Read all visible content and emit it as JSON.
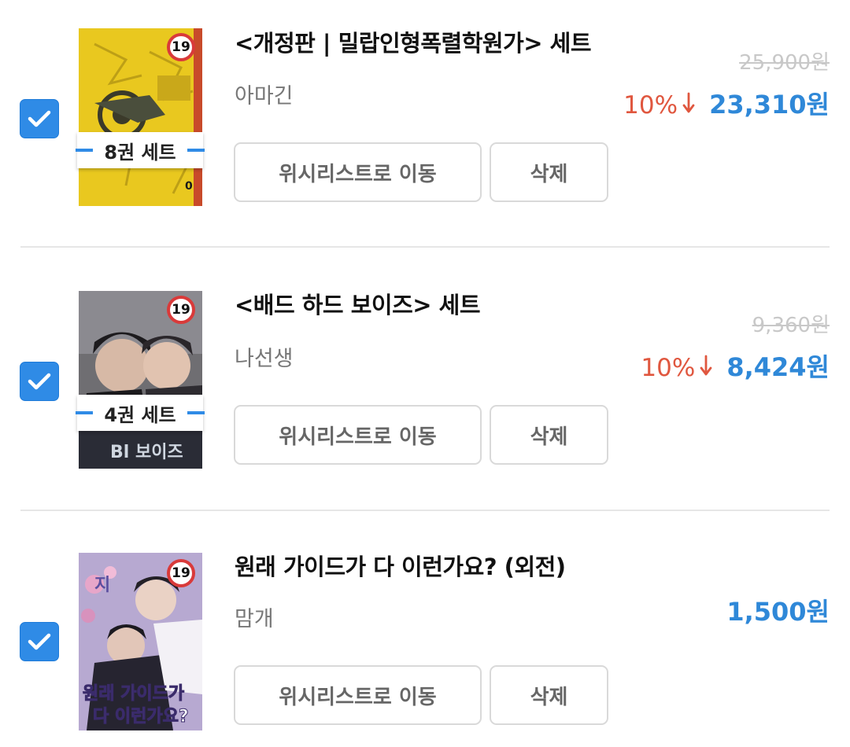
{
  "items": [
    {
      "title": "<개정판 | 밀랍인형폭렬학원가> 세트",
      "author": "아마긴",
      "set_label": "8권 세트",
      "age": "19",
      "original_price": "25,900원",
      "discount": "10%",
      "price": "23,310원",
      "wishlist_label": "위시리스트로 이동",
      "delete_label": "삭제",
      "checked": true
    },
    {
      "title": "<배드 하드 보이즈> 세트",
      "author": "나선생",
      "set_label": "4권 세트",
      "age": "19",
      "original_price": "9,360원",
      "discount": "10%",
      "price": "8,424원",
      "wishlist_label": "위시리스트로 이동",
      "delete_label": "삭제",
      "checked": true
    },
    {
      "title": "원래 가이드가 다 이런가요? (외전)",
      "author": "맘개",
      "age": "19",
      "price": "1,500원",
      "wishlist_label": "위시리스트로 이동",
      "delete_label": "삭제",
      "checked": true
    }
  ],
  "colors": {
    "accent": "#2f8be6",
    "price": "#2f88d8",
    "discount": "#e0573f",
    "age_badge": "#d93a3a"
  }
}
